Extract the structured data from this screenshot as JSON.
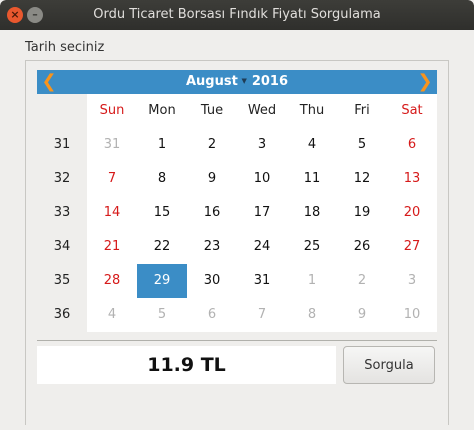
{
  "window": {
    "title": "Ordu Ticaret Borsası Fındık Fiyatı Sorgulama"
  },
  "label": "Tarih seciniz",
  "calendar": {
    "month": "August",
    "year": "2016",
    "prev_glyph": "❮",
    "next_glyph": "❯",
    "weekdays": [
      "Sun",
      "Mon",
      "Tue",
      "Wed",
      "Thu",
      "Fri",
      "Sat"
    ],
    "week_numbers": [
      "31",
      "32",
      "33",
      "34",
      "35",
      "36"
    ],
    "days": [
      [
        "31",
        "1",
        "2",
        "3",
        "4",
        "5",
        "6"
      ],
      [
        "7",
        "8",
        "9",
        "10",
        "11",
        "12",
        "13"
      ],
      [
        "14",
        "15",
        "16",
        "17",
        "18",
        "19",
        "20"
      ],
      [
        "21",
        "22",
        "23",
        "24",
        "25",
        "26",
        "27"
      ],
      [
        "28",
        "29",
        "30",
        "31",
        "1",
        "2",
        "3"
      ],
      [
        "4",
        "5",
        "6",
        "7",
        "8",
        "9",
        "10"
      ]
    ],
    "selected": "29",
    "accent_color": "#3b8dc6",
    "weekend_color": "#d61a1a"
  },
  "result": {
    "price": "11.9 TL"
  },
  "button": {
    "label": "Sorgula"
  }
}
